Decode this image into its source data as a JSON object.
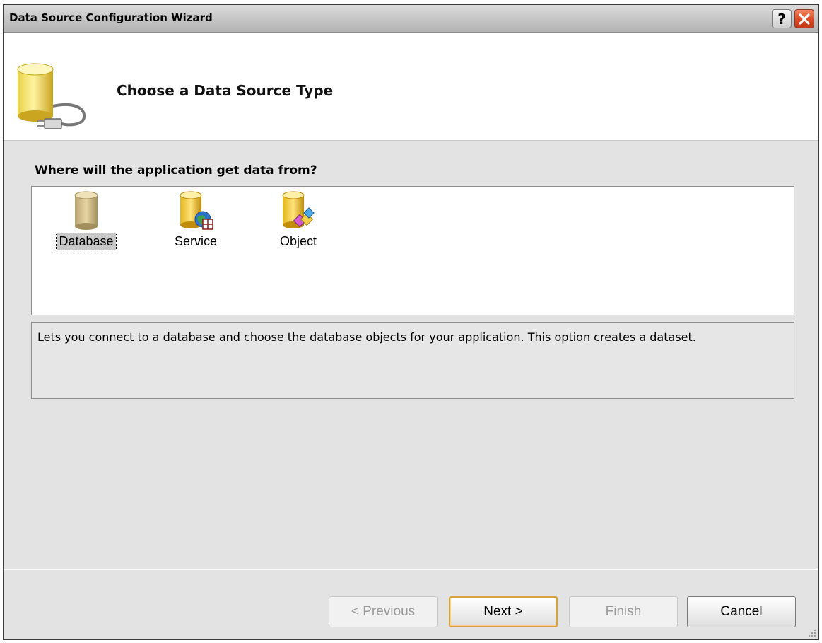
{
  "window": {
    "title": "Data Source Configuration Wizard",
    "help_label": "?",
    "close_icon": "close-icon",
    "accent_close": "#d84a23"
  },
  "header": {
    "title": "Choose a Data Source Type",
    "icon": "database-plug-icon"
  },
  "question": "Where will the application get data from?",
  "source_types": [
    {
      "label": "Database",
      "icon": "database-icon",
      "selected": true
    },
    {
      "label": "Service",
      "icon": "service-icon",
      "selected": false
    },
    {
      "label": "Object",
      "icon": "object-icon",
      "selected": false
    }
  ],
  "description": "Lets you connect to a database and choose the database objects for your application. This option creates a dataset.",
  "buttons": {
    "previous": {
      "label": "< Previous",
      "enabled": false
    },
    "next": {
      "label": "Next >",
      "enabled": true,
      "default": true
    },
    "finish": {
      "label": "Finish",
      "enabled": false
    },
    "cancel": {
      "label": "Cancel",
      "enabled": true
    }
  }
}
